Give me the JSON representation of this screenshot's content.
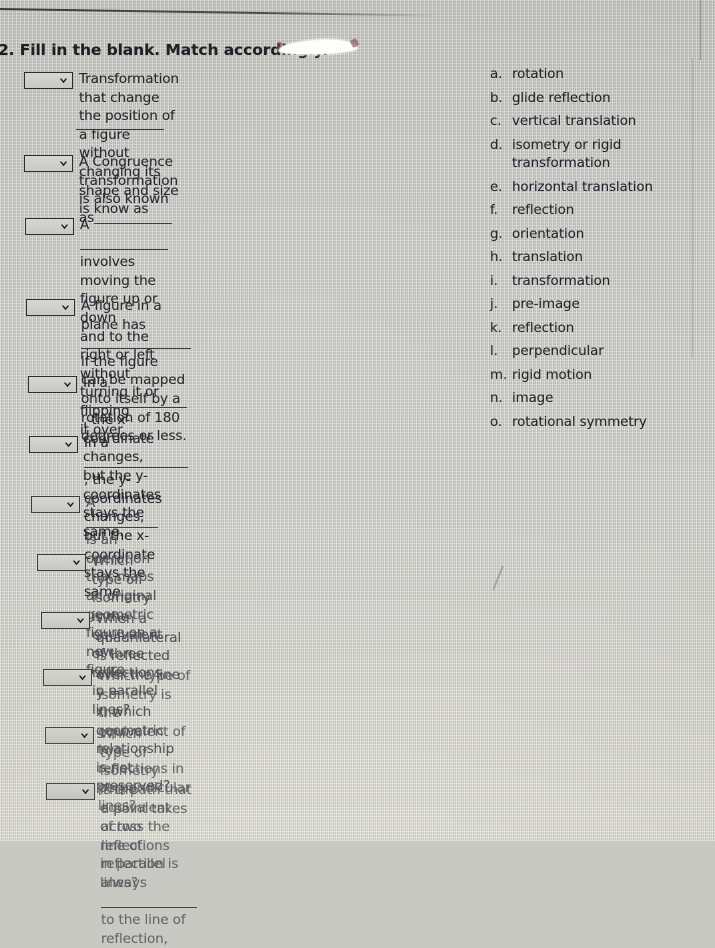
{
  "page": {
    "question_number_prefix": "2.",
    "question_heading": "2. Fill in the blank. Match accordingly.",
    "redaction": "whiteout-correction-mark"
  },
  "prompts": [
    {
      "id": "q1",
      "dropdown": "chevron-down-icon",
      "selected": "",
      "parts": [
        "Transformation that change the position of a figure without changing its shape and size is know as"
      ],
      "trailing_blank": true,
      "text_plain": "Transformation that change the position of a figure without changing its shape and size is know as ____________"
    },
    {
      "id": "q2",
      "dropdown": "chevron-down-icon",
      "selected": "",
      "text_plain": "A Congruence transformation is also known as____________"
    },
    {
      "id": "q3",
      "dropdown": "chevron-down-icon",
      "selected": "",
      "text_plain": "A ____________ involves moving the figure up or down and to the right or left without turning it or flipping it over."
    },
    {
      "id": "q4",
      "dropdown": "chevron-down-icon",
      "selected": "",
      "text_plain": "A figure in a plane has ____________ if the figure can be mapped onto itself by a rotation of 180 degrees or less."
    },
    {
      "id": "q5",
      "dropdown": "chevron-down-icon",
      "selected": "",
      "text_plain": "In a ____________, the x-coordinate changes, but the y-coordinates stays the same."
    },
    {
      "id": "q6",
      "dropdown": "chevron-down-icon",
      "selected": "",
      "text_plain": "In a ____________, the y-coordinates changes, but the x-coordinate stays the same."
    },
    {
      "id": "q7",
      "dropdown": "chevron-down-icon",
      "selected": "",
      "text_plain": "A____________ is an operation that maps an original geometric figure on a new figure."
    },
    {
      "id": "q8",
      "dropdown": "chevron-down-icon",
      "selected": "",
      "text_plain": "Which type of isometry is the equivalent of three reflections in parallel lines?"
    },
    {
      "id": "q9",
      "dropdown": "chevron-down-icon",
      "selected": "",
      "text_plain": "When a quadrilateral is reflected over the line y = x, which geometric relationship is not preserved?"
    },
    {
      "id": "q10",
      "dropdown": "chevron-down-icon",
      "selected": "",
      "text_plain": "Which type of isometry is the equivalent of two reflections in perpendicular lines?"
    },
    {
      "id": "q11",
      "dropdown": "chevron-down-icon",
      "selected": "",
      "text_plain": "Which type of isometry is the equivalent of two reflections in parallel lines?"
    },
    {
      "id": "q12",
      "dropdown": "chevron-down-icon",
      "selected": "",
      "text_plain": "The path that a point takes across the line of reflection is always ____________ to the line of reflection,"
    }
  ],
  "q1": {
    "line1": "Transformation that change the position of a figure",
    "line2": "without changing its shape and size is know as"
  },
  "q2": {
    "line1": "A Congruence transformation is also known",
    "line2_pre": "as"
  },
  "q3": {
    "line1_pre": "A",
    "line1_post": "involves moving the figure up or down",
    "line2": "and to the right or left without turning it or flipping",
    "line3": "it over."
  },
  "q4": {
    "line1_pre": "A figure in a plane has",
    "line1_post": "if the figure",
    "line2": "can be mapped onto itself by a rotation of 180",
    "line3": "degrees or less."
  },
  "q5": {
    "line1_pre": "In a",
    "line1_post": ", the x-coordinate changes,",
    "line2": "but the y-coordinates stays the same."
  },
  "q6": {
    "line1_pre": "In a",
    "line1_post": ", the y-coordinates changes,",
    "line2": "but the x-coordinate stays the same."
  },
  "q7": {
    "line1_pre": "A",
    "line1_post": "is an operation that maps an original",
    "line2": "geometric figure on a new figure."
  },
  "q8": {
    "line1": "Which type of isometry is the equivalent of three",
    "line2": "reflections in parallel lines?"
  },
  "q9": {
    "line1": "When a quadrilateral is reflected over the line y =",
    "line2": "x, which geometric relationship is not preserved?"
  },
  "q10": {
    "line1": "Which type of isometry is the equivalent of two",
    "line2": "reflections in perpendicular lines?"
  },
  "q11": {
    "line1": "Which type of isometry is the equivalent of two",
    "line2": "reflections in parallel lines?"
  },
  "q12": {
    "line1": "The path that a point takes across the line of",
    "line2_pre": "reflection is always",
    "line2_post": "to the line of",
    "line3": "reflection,"
  },
  "options": [
    {
      "label": "a.",
      "value": "rotation"
    },
    {
      "label": "b.",
      "value": "glide reflection"
    },
    {
      "label": "c.",
      "value": "vertical translation"
    },
    {
      "label": "d.",
      "value": "isometry or rigid transformation"
    },
    {
      "label": "e.",
      "value": "horizontal translation"
    },
    {
      "label": "f.",
      "value": "reflection"
    },
    {
      "label": "g.",
      "value": "orientation"
    },
    {
      "label": "h.",
      "value": "translation"
    },
    {
      "label": "i.",
      "value": "transformation"
    },
    {
      "label": "j.",
      "value": "pre-image"
    },
    {
      "label": "k.",
      "value": "reflection"
    },
    {
      "label": "l.",
      "value": "perpendicular"
    },
    {
      "label": "m.",
      "value": "rigid motion"
    },
    {
      "label": "n.",
      "value": "image"
    },
    {
      "label": "o.",
      "value": "rotational symmetry"
    }
  ],
  "colors": {
    "background": "#cdcdc7",
    "text": "#23232a",
    "select_border": "#2a2a2c",
    "whiteout": "#fdfdfb"
  }
}
